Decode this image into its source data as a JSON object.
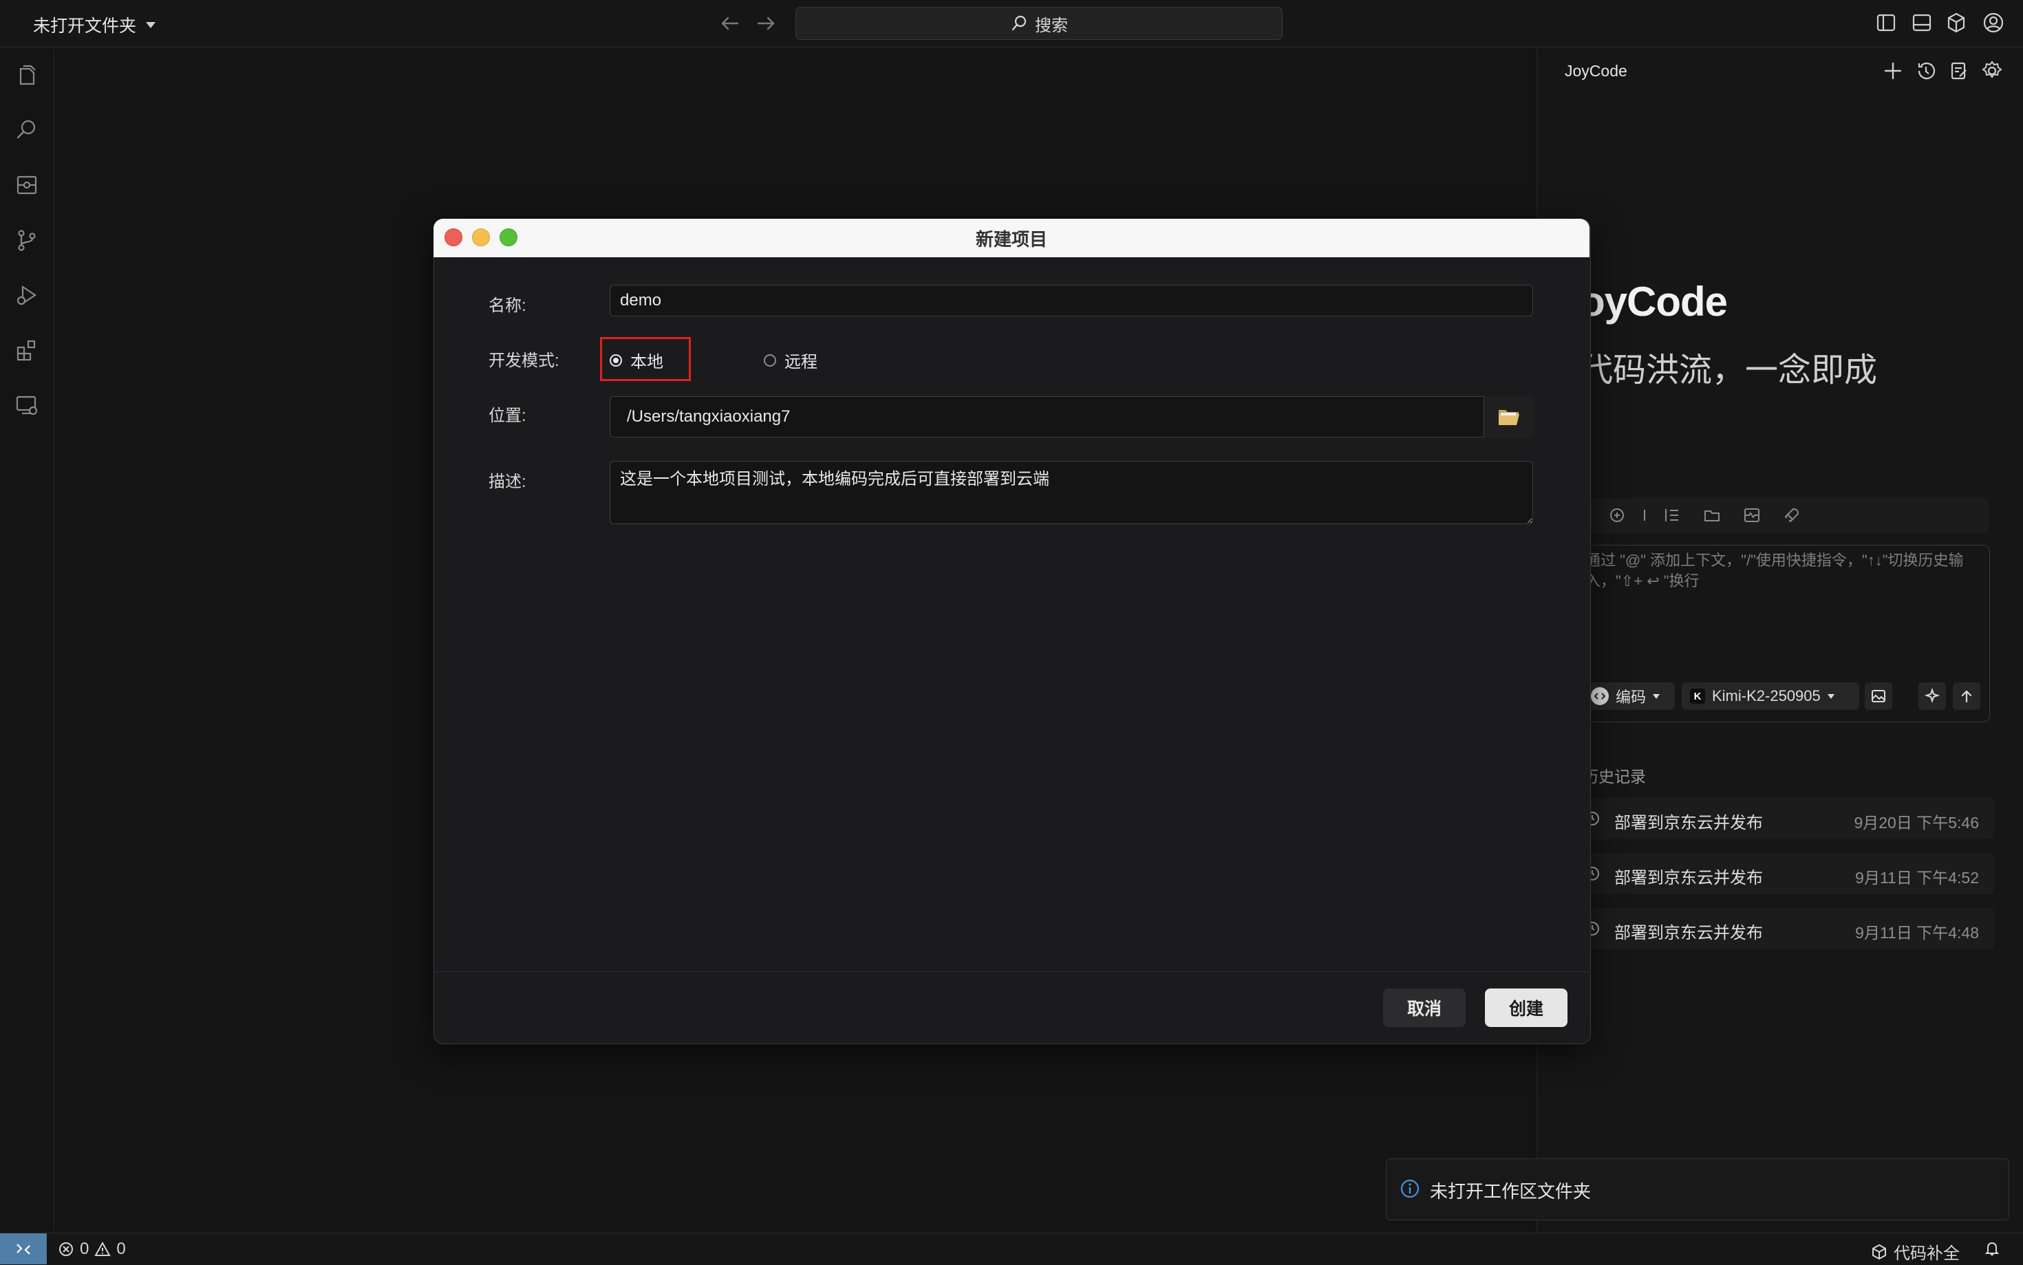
{
  "titlebar": {
    "folder_title": "未打开文件夹",
    "search_label": "搜索"
  },
  "right_panel": {
    "title": "JoyCode",
    "brand": "oyCode",
    "slogan": "代码洪流，一念即成",
    "input_placeholder": "通过 \"@\" 添加上下文，\"/\"使用快捷指令，\"↑↓\"切换历史输入，\"⇧+ ↩ \"换行",
    "mode_chip": "编码",
    "model_chip": "Kimi-K2-250905",
    "history_title": "历史记录",
    "history": [
      {
        "title": "部署到京东云并发布",
        "time": "9月20日 下午5:46"
      },
      {
        "title": "部署到京东云并发布",
        "time": "9月11日 下午4:52"
      },
      {
        "title": "部署到京东云并发布",
        "time": "9月11日 下午4:48"
      }
    ]
  },
  "notification": {
    "text": "未打开工作区文件夹"
  },
  "statusbar": {
    "errors": "0",
    "warnings": "0",
    "completion": "代码补全"
  },
  "dialog": {
    "title": "新建项目",
    "name_label": "名称:",
    "name_value": "demo",
    "mode_label": "开发模式:",
    "mode_local": "本地",
    "mode_remote": "远程",
    "selected_mode": "本地",
    "location_label": "位置:",
    "location_value": "/Users/tangxiaoxiang7",
    "desc_label": "描述:",
    "desc_value": "这是一个本地项目测试，本地编码完成后可直接部署到云端",
    "cancel": "取消",
    "create": "创建"
  },
  "colors": {
    "background": "#141414",
    "highlight": "#e02020",
    "traffic_red": "#ee5f57",
    "traffic_yellow": "#f5be4f",
    "traffic_green": "#57c038",
    "status_remote": "#4f7fa6",
    "info_blue": "#4a90e2"
  }
}
